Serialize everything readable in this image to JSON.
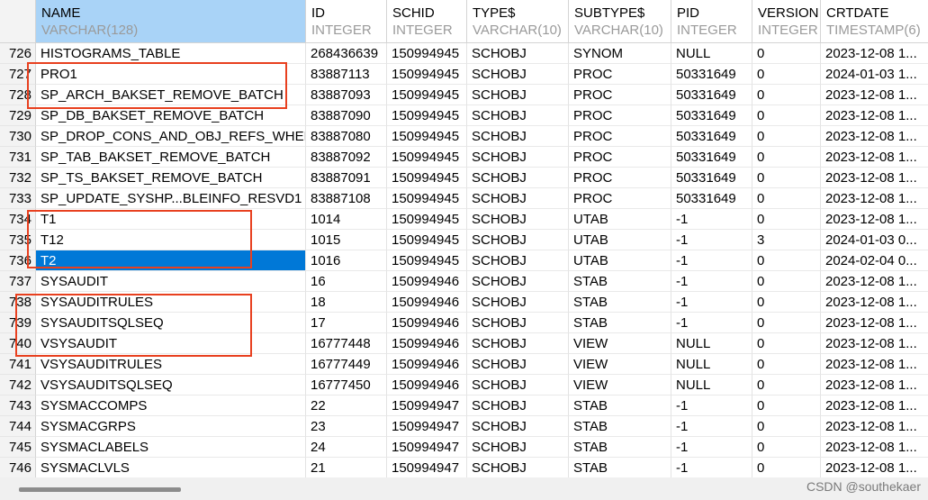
{
  "columns": [
    {
      "name": "NAME",
      "type": "VARCHAR(128)"
    },
    {
      "name": "ID",
      "type": "INTEGER"
    },
    {
      "name": "SCHID",
      "type": "INTEGER"
    },
    {
      "name": "TYPE$",
      "type": "VARCHAR(10)"
    },
    {
      "name": "SUBTYPE$",
      "type": "VARCHAR(10)"
    },
    {
      "name": "PID",
      "type": "INTEGER"
    },
    {
      "name": "VERSION",
      "type": "INTEGER"
    },
    {
      "name": "CRTDATE",
      "type": "TIMESTAMP(6)"
    }
  ],
  "rows": [
    {
      "num": "726",
      "cells": [
        "HISTOGRAMS_TABLE",
        "268436639",
        "150994945",
        "SCHOBJ",
        "SYNOM",
        "NULL",
        "0",
        "2023-12-08 1..."
      ]
    },
    {
      "num": "727",
      "cells": [
        "PRO1",
        "83887113",
        "150994945",
        "SCHOBJ",
        "PROC",
        "50331649",
        "0",
        "2024-01-03 1..."
      ]
    },
    {
      "num": "728",
      "cells": [
        "SP_ARCH_BAKSET_REMOVE_BATCH",
        "83887093",
        "150994945",
        "SCHOBJ",
        "PROC",
        "50331649",
        "0",
        "2023-12-08 1..."
      ]
    },
    {
      "num": "729",
      "cells": [
        "SP_DB_BAKSET_REMOVE_BATCH",
        "83887090",
        "150994945",
        "SCHOBJ",
        "PROC",
        "50331649",
        "0",
        "2023-12-08 1..."
      ]
    },
    {
      "num": "730",
      "cells": [
        "SP_DROP_CONS_AND_OBJ_REFS_WHEN_",
        "83887080",
        "150994945",
        "SCHOBJ",
        "PROC",
        "50331649",
        "0",
        "2023-12-08 1..."
      ]
    },
    {
      "num": "731",
      "cells": [
        "SP_TAB_BAKSET_REMOVE_BATCH",
        "83887092",
        "150994945",
        "SCHOBJ",
        "PROC",
        "50331649",
        "0",
        "2023-12-08 1..."
      ]
    },
    {
      "num": "732",
      "cells": [
        "SP_TS_BAKSET_REMOVE_BATCH",
        "83887091",
        "150994945",
        "SCHOBJ",
        "PROC",
        "50331649",
        "0",
        "2023-12-08 1..."
      ]
    },
    {
      "num": "733",
      "cells": [
        "SP_UPDATE_SYSHP...BLEINFO_RESVD1",
        "83887108",
        "150994945",
        "SCHOBJ",
        "PROC",
        "50331649",
        "0",
        "2023-12-08 1..."
      ]
    },
    {
      "num": "734",
      "cells": [
        "T1",
        "1014",
        "150994945",
        "SCHOBJ",
        "UTAB",
        "-1",
        "0",
        "2023-12-08 1..."
      ]
    },
    {
      "num": "735",
      "cells": [
        "T12",
        "1015",
        "150994945",
        "SCHOBJ",
        "UTAB",
        "-1",
        "3",
        "2024-01-03 0..."
      ]
    },
    {
      "num": "736",
      "cells": [
        "T2",
        "1016",
        "150994945",
        "SCHOBJ",
        "UTAB",
        "-1",
        "0",
        "2024-02-04 0..."
      ]
    },
    {
      "num": "737",
      "cells": [
        "SYSAUDIT",
        "16",
        "150994946",
        "SCHOBJ",
        "STAB",
        "-1",
        "0",
        "2023-12-08 1..."
      ]
    },
    {
      "num": "738",
      "cells": [
        "SYSAUDITRULES",
        "18",
        "150994946",
        "SCHOBJ",
        "STAB",
        "-1",
        "0",
        "2023-12-08 1..."
      ]
    },
    {
      "num": "739",
      "cells": [
        "SYSAUDITSQLSEQ",
        "17",
        "150994946",
        "SCHOBJ",
        "STAB",
        "-1",
        "0",
        "2023-12-08 1..."
      ]
    },
    {
      "num": "740",
      "cells": [
        "VSYSAUDIT",
        "16777448",
        "150994946",
        "SCHOBJ",
        "VIEW",
        "NULL",
        "0",
        "2023-12-08 1..."
      ]
    },
    {
      "num": "741",
      "cells": [
        "VSYSAUDITRULES",
        "16777449",
        "150994946",
        "SCHOBJ",
        "VIEW",
        "NULL",
        "0",
        "2023-12-08 1..."
      ]
    },
    {
      "num": "742",
      "cells": [
        "VSYSAUDITSQLSEQ",
        "16777450",
        "150994946",
        "SCHOBJ",
        "VIEW",
        "NULL",
        "0",
        "2023-12-08 1..."
      ]
    },
    {
      "num": "743",
      "cells": [
        "SYSMACCOMPS",
        "22",
        "150994947",
        "SCHOBJ",
        "STAB",
        "-1",
        "0",
        "2023-12-08 1..."
      ]
    },
    {
      "num": "744",
      "cells": [
        "SYSMACGRPS",
        "23",
        "150994947",
        "SCHOBJ",
        "STAB",
        "-1",
        "0",
        "2023-12-08 1..."
      ]
    },
    {
      "num": "745",
      "cells": [
        "SYSMACLABELS",
        "24",
        "150994947",
        "SCHOBJ",
        "STAB",
        "-1",
        "0",
        "2023-12-08 1..."
      ]
    },
    {
      "num": "746",
      "cells": [
        "SYSMACLVLS",
        "21",
        "150994947",
        "SCHOBJ",
        "STAB",
        "-1",
        "0",
        "2023-12-08 1..."
      ]
    }
  ],
  "selected_row": 10,
  "selected_col": 0,
  "watermark": "CSDN @southekaer",
  "colors": {
    "selected_header": "#a9d3f7",
    "selected_cell": "#0078d7",
    "annotation_box": "#e8401f"
  }
}
